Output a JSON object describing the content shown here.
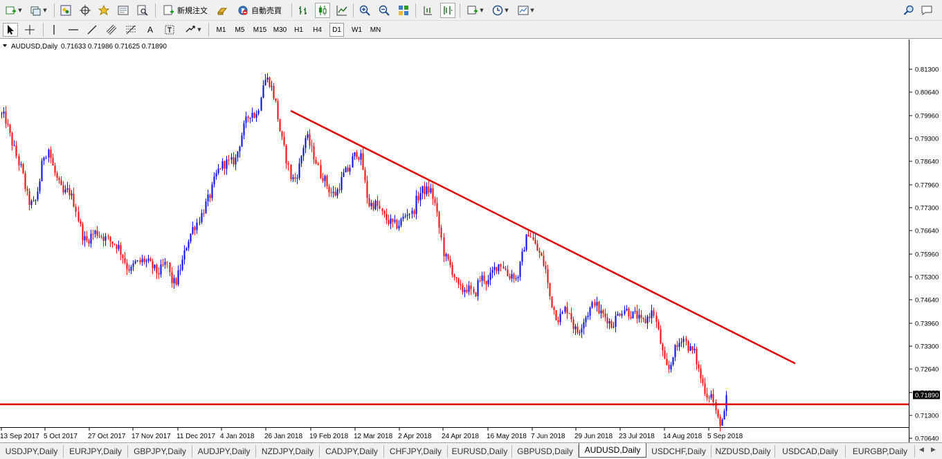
{
  "toolbar": {
    "new_order_label": "新規注文",
    "auto_trading_label": "自動売買",
    "timeframes": [
      "M1",
      "M5",
      "M15",
      "M30",
      "H1",
      "H4",
      "D1",
      "W1",
      "MN"
    ],
    "active_timeframe": "D1"
  },
  "chart": {
    "header_symbol": "AUDUSD,Daily",
    "header_ohlc": "0.71633 0.71986 0.71625 0.71890",
    "current_price": "0.71890",
    "colors": {
      "bull": "#0000ff",
      "bear": "#ff0000",
      "trendline": "#e00000",
      "support": "#e00000",
      "background": "#ffffff"
    }
  },
  "chart_data": {
    "type": "candlestick",
    "symbol": "AUDUSD",
    "timeframe": "Daily",
    "ylim": [
      0.7025,
      0.8176
    ],
    "y_ticks": [
      "0.81300",
      "0.80640",
      "0.79960",
      "0.79300",
      "0.78640",
      "0.77960",
      "0.77300",
      "0.76640",
      "0.75960",
      "0.75300",
      "0.74640",
      "0.73960",
      "0.73300",
      "0.72640",
      "0.71960",
      "0.71300",
      "0.70640"
    ],
    "x_ticks": [
      "13 Sep 2017",
      "5 Oct 2017",
      "27 Oct 2017",
      "17 Nov 2017",
      "11 Dec 2017",
      "4 Jan 2018",
      "26 Jan 2018",
      "19 Feb 2018",
      "12 Mar 2018",
      "2 Apr 2018",
      "24 Apr 2018",
      "16 May 2018",
      "7 Jun 2018",
      "29 Jun 2018",
      "23 Jul 2018",
      "14 Aug 2018",
      "5 Sep 2018"
    ],
    "close_path": [
      [
        0,
        0.8
      ],
      [
        7,
        0.799
      ],
      [
        15,
        0.793
      ],
      [
        23,
        0.788
      ],
      [
        31,
        0.784
      ],
      [
        38,
        0.777
      ],
      [
        43,
        0.774
      ],
      [
        50,
        0.774
      ],
      [
        57,
        0.781
      ],
      [
        62,
        0.788
      ],
      [
        70,
        0.79
      ],
      [
        77,
        0.784
      ],
      [
        84,
        0.78
      ],
      [
        91,
        0.777
      ],
      [
        99,
        0.778
      ],
      [
        107,
        0.774
      ],
      [
        114,
        0.769
      ],
      [
        119,
        0.765
      ],
      [
        124,
        0.763
      ],
      [
        131,
        0.765
      ],
      [
        138,
        0.766
      ],
      [
        146,
        0.765
      ],
      [
        153,
        0.764
      ],
      [
        162,
        0.763
      ],
      [
        170,
        0.762
      ],
      [
        177,
        0.759
      ],
      [
        183,
        0.756
      ],
      [
        189,
        0.755
      ],
      [
        194,
        0.757
      ],
      [
        200,
        0.757
      ],
      [
        207,
        0.758
      ],
      [
        214,
        0.757
      ],
      [
        219,
        0.756
      ],
      [
        228,
        0.754
      ],
      [
        235,
        0.756
      ],
      [
        241,
        0.757
      ],
      [
        247,
        0.752
      ],
      [
        253,
        0.751
      ],
      [
        259,
        0.755
      ],
      [
        264,
        0.758
      ],
      [
        270,
        0.763
      ],
      [
        278,
        0.767
      ],
      [
        285,
        0.769
      ],
      [
        291,
        0.771
      ],
      [
        297,
        0.774
      ],
      [
        304,
        0.777
      ],
      [
        311,
        0.782
      ],
      [
        318,
        0.785
      ],
      [
        326,
        0.786
      ],
      [
        333,
        0.786
      ],
      [
        340,
        0.787
      ],
      [
        345,
        0.791
      ],
      [
        350,
        0.795
      ],
      [
        357,
        0.799
      ],
      [
        363,
        0.801
      ],
      [
        369,
        0.799
      ],
      [
        375,
        0.804
      ],
      [
        381,
        0.81
      ],
      [
        388,
        0.81
      ],
      [
        393,
        0.807
      ],
      [
        398,
        0.803
      ],
      [
        405,
        0.794
      ],
      [
        412,
        0.788
      ],
      [
        419,
        0.782
      ],
      [
        425,
        0.781
      ],
      [
        431,
        0.784
      ],
      [
        437,
        0.79
      ],
      [
        442,
        0.794
      ],
      [
        449,
        0.79
      ],
      [
        455,
        0.787
      ],
      [
        461,
        0.783
      ],
      [
        467,
        0.782
      ],
      [
        473,
        0.779
      ],
      [
        479,
        0.777
      ],
      [
        485,
        0.777
      ],
      [
        491,
        0.78
      ],
      [
        497,
        0.783
      ],
      [
        503,
        0.784
      ],
      [
        509,
        0.787
      ],
      [
        515,
        0.789
      ],
      [
        522,
        0.787
      ],
      [
        527,
        0.78
      ],
      [
        532,
        0.774
      ],
      [
        537,
        0.774
      ],
      [
        543,
        0.774
      ],
      [
        549,
        0.772
      ],
      [
        556,
        0.77
      ],
      [
        562,
        0.769
      ],
      [
        568,
        0.768
      ],
      [
        575,
        0.768
      ],
      [
        582,
        0.77
      ],
      [
        589,
        0.772
      ],
      [
        596,
        0.771
      ],
      [
        601,
        0.775
      ],
      [
        609,
        0.778
      ],
      [
        616,
        0.778
      ],
      [
        622,
        0.778
      ],
      [
        628,
        0.774
      ],
      [
        635,
        0.766
      ],
      [
        642,
        0.759
      ],
      [
        648,
        0.757
      ],
      [
        655,
        0.754
      ],
      [
        661,
        0.75
      ],
      [
        667,
        0.749
      ],
      [
        673,
        0.75
      ],
      [
        679,
        0.749
      ],
      [
        685,
        0.747
      ],
      [
        691,
        0.752
      ],
      [
        698,
        0.753
      ],
      [
        704,
        0.751
      ],
      [
        710,
        0.754
      ],
      [
        716,
        0.756
      ],
      [
        722,
        0.757
      ],
      [
        728,
        0.756
      ],
      [
        734,
        0.753
      ],
      [
        740,
        0.754
      ],
      [
        746,
        0.752
      ],
      [
        752,
        0.757
      ],
      [
        757,
        0.762
      ],
      [
        763,
        0.766
      ],
      [
        769,
        0.764
      ],
      [
        775,
        0.761
      ],
      [
        781,
        0.759
      ],
      [
        788,
        0.755
      ],
      [
        793,
        0.748
      ],
      [
        799,
        0.744
      ],
      [
        805,
        0.741
      ],
      [
        811,
        0.742
      ],
      [
        817,
        0.744
      ],
      [
        823,
        0.743
      ],
      [
        829,
        0.738
      ],
      [
        835,
        0.737
      ],
      [
        841,
        0.74
      ],
      [
        847,
        0.742
      ],
      [
        853,
        0.744
      ],
      [
        859,
        0.746
      ],
      [
        865,
        0.743
      ],
      [
        871,
        0.742
      ],
      [
        877,
        0.741
      ],
      [
        883,
        0.739
      ],
      [
        889,
        0.741
      ],
      [
        895,
        0.743
      ],
      [
        901,
        0.744
      ],
      [
        907,
        0.743
      ],
      [
        913,
        0.742
      ],
      [
        919,
        0.742
      ],
      [
        925,
        0.74
      ],
      [
        931,
        0.74
      ],
      [
        937,
        0.742
      ],
      [
        943,
        0.743
      ],
      [
        949,
        0.739
      ],
      [
        955,
        0.733
      ],
      [
        961,
        0.727
      ],
      [
        967,
        0.726
      ],
      [
        972,
        0.731
      ],
      [
        979,
        0.733
      ],
      [
        985,
        0.736
      ],
      [
        991,
        0.734
      ],
      [
        997,
        0.732
      ],
      [
        1003,
        0.731
      ],
      [
        1009,
        0.726
      ],
      [
        1015,
        0.722
      ],
      [
        1021,
        0.719
      ],
      [
        1027,
        0.719
      ],
      [
        1031,
        0.716
      ],
      [
        1036,
        0.712
      ],
      [
        1041,
        0.711
      ],
      [
        1046,
        0.713
      ],
      [
        1049,
        0.7189
      ]
    ],
    "trendline": {
      "start": {
        "date": "late Jan 2018",
        "price": 0.801
      },
      "end": {
        "date": "after 5 Sep 2018",
        "price": 0.728
      }
    },
    "support_level": 0.7162,
    "last_price": 0.7189
  },
  "symbol_tabs": {
    "items": [
      "USDJPY,Daily",
      "EURJPY,Daily",
      "GBPJPY,Daily",
      "AUDJPY,Daily",
      "NZDJPY,Daily",
      "CADJPY,Daily",
      "CHFJPY,Daily",
      "EURUSD,Daily",
      "GBPUSD,Daily",
      "AUDUSD,Daily",
      "USDCHF,Daily",
      "NZDUSD,Daily",
      "USDCAD,Daily",
      "EURGBP,Daily"
    ],
    "active": "AUDUSD,Daily"
  }
}
